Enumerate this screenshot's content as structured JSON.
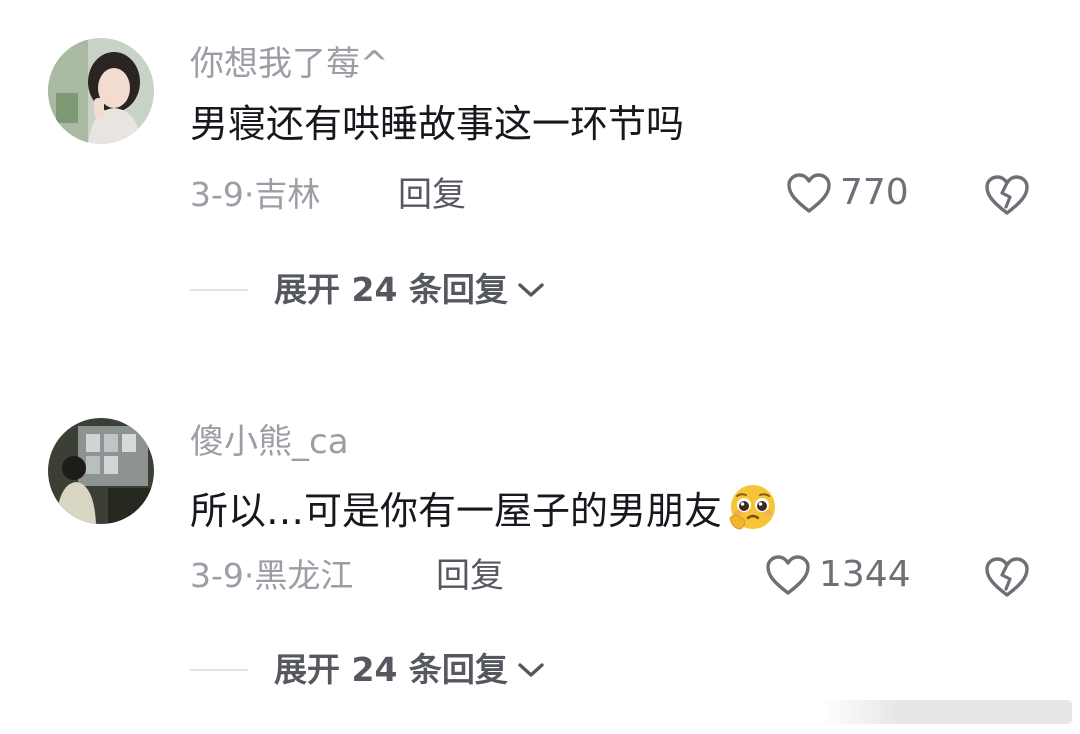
{
  "comments": [
    {
      "username": "你想我了莓^",
      "text": "男寝还有哄睡故事这一环节吗",
      "meta": "3-9·吉林",
      "reply_label": "回复",
      "likes": "770",
      "expand_label": "展开 24 条回复"
    },
    {
      "username": "傻小熊_ca",
      "text": "所以…可是你有一屋子的男朋友",
      "meta": "3-9·黑龙江",
      "reply_label": "回复",
      "likes": "1344",
      "expand_label": "展开 24 条回复"
    }
  ],
  "colors": {
    "username": "#9b9ea4",
    "text": "#16181d",
    "icon": "#6d7076"
  },
  "icons": [
    "heart-icon",
    "broken-heart-icon",
    "chevron-down-icon",
    "pleading-face-emoji"
  ]
}
